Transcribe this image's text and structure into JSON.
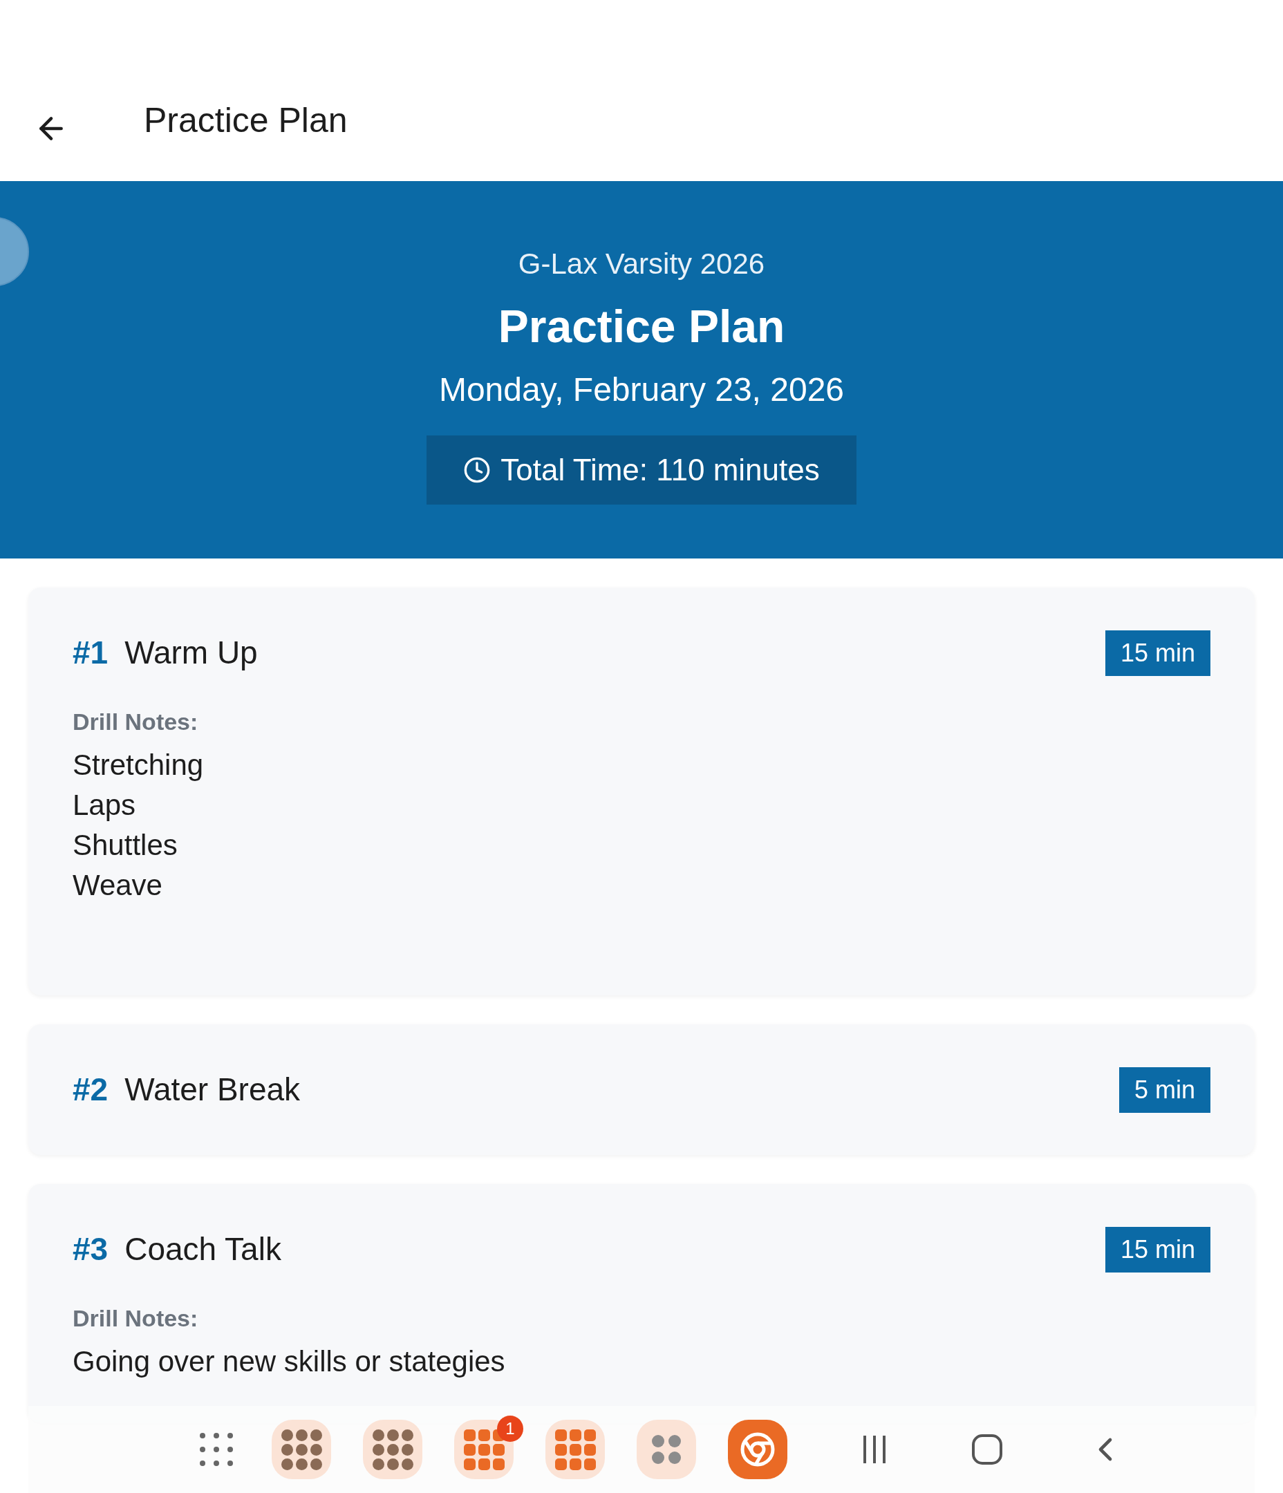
{
  "top_bar": {
    "title": "Practice Plan"
  },
  "header": {
    "team": "G-Lax Varsity 2026",
    "title": "Practice Plan",
    "date": "Monday, February 23, 2026",
    "total_time": "Total Time: 110 minutes"
  },
  "drills": [
    {
      "number": "#1",
      "name": "Warm Up",
      "duration": "15 min",
      "notes_label": "Drill Notes:",
      "notes": [
        "Stretching",
        "Laps",
        "Shuttles",
        "Weave"
      ]
    },
    {
      "number": "#2",
      "name": "Water Break",
      "duration": "5 min"
    },
    {
      "number": "#3",
      "name": "Coach Talk",
      "duration": "15 min",
      "notes_label": "Drill Notes:",
      "notes": [
        "Going over new skills or stategies"
      ]
    }
  ],
  "taskbar": {
    "notification_badge": "1"
  }
}
